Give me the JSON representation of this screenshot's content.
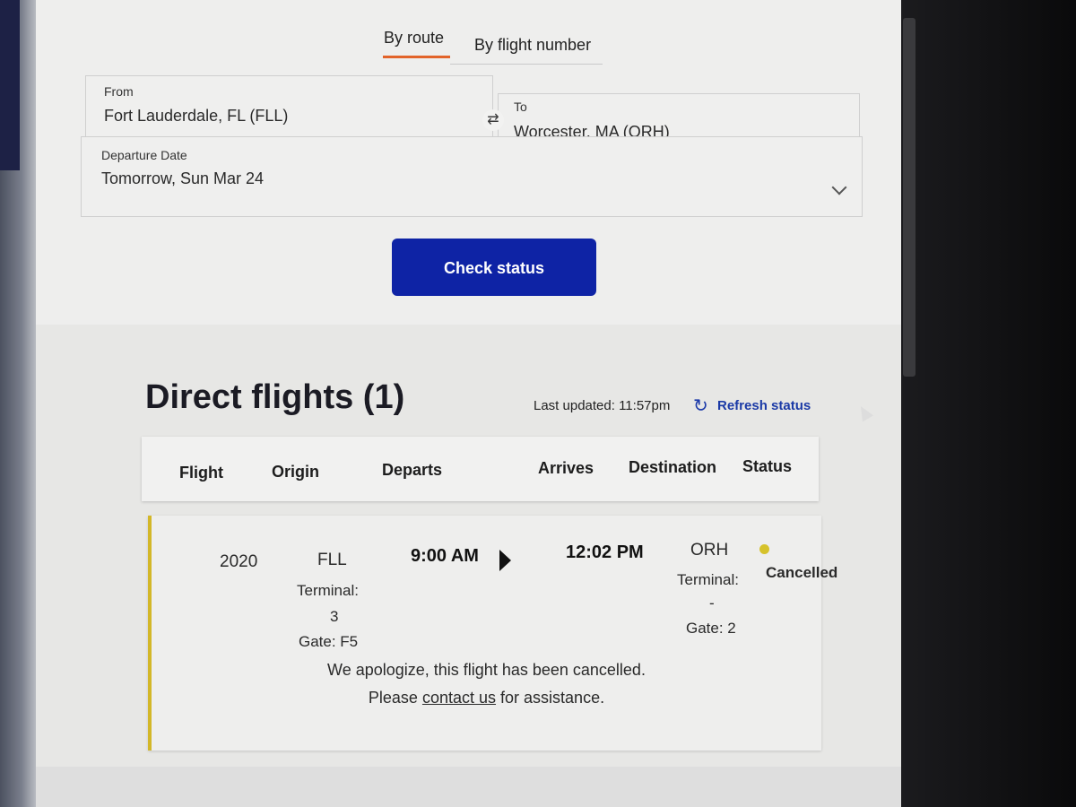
{
  "tabs": {
    "by_route": "By route",
    "by_flight_number": "By flight number"
  },
  "search": {
    "from_label": "From",
    "from_value": "Fort Lauderdale, FL (FLL)",
    "to_label": "To",
    "to_value": "Worcester, MA (ORH)",
    "date_label": "Departure Date",
    "date_value": "Tomorrow, Sun Mar 24",
    "swap_icon": "⇄",
    "submit_label": "Check status"
  },
  "results": {
    "title": "Direct flights (1)",
    "last_updated": "Last updated: 11:57pm",
    "refresh_label": "Refresh status",
    "columns": [
      "Flight",
      "Origin",
      "Departs",
      "Arrives",
      "Destination",
      "Status"
    ],
    "flight": {
      "number": "2020",
      "origin_code": "FLL",
      "origin_terminal_label": "Terminal:",
      "origin_terminal": "3",
      "origin_gate": "Gate: F5",
      "departs": "9:00 AM",
      "arrives": "12:02 PM",
      "dest_code": "ORH",
      "dest_terminal_label": "Terminal:",
      "dest_terminal": "-",
      "dest_gate": "Gate: 2",
      "status": "Cancelled",
      "status_color": "#d6c22b"
    },
    "message_line1": "We apologize, this flight has been cancelled.",
    "message_please": "Please",
    "message_link": "contact us",
    "message_tail": "for assistance."
  },
  "colors": {
    "primary_button": "#0e23a5",
    "tab_accent": "#e2632a",
    "link": "#1b3aa6"
  }
}
